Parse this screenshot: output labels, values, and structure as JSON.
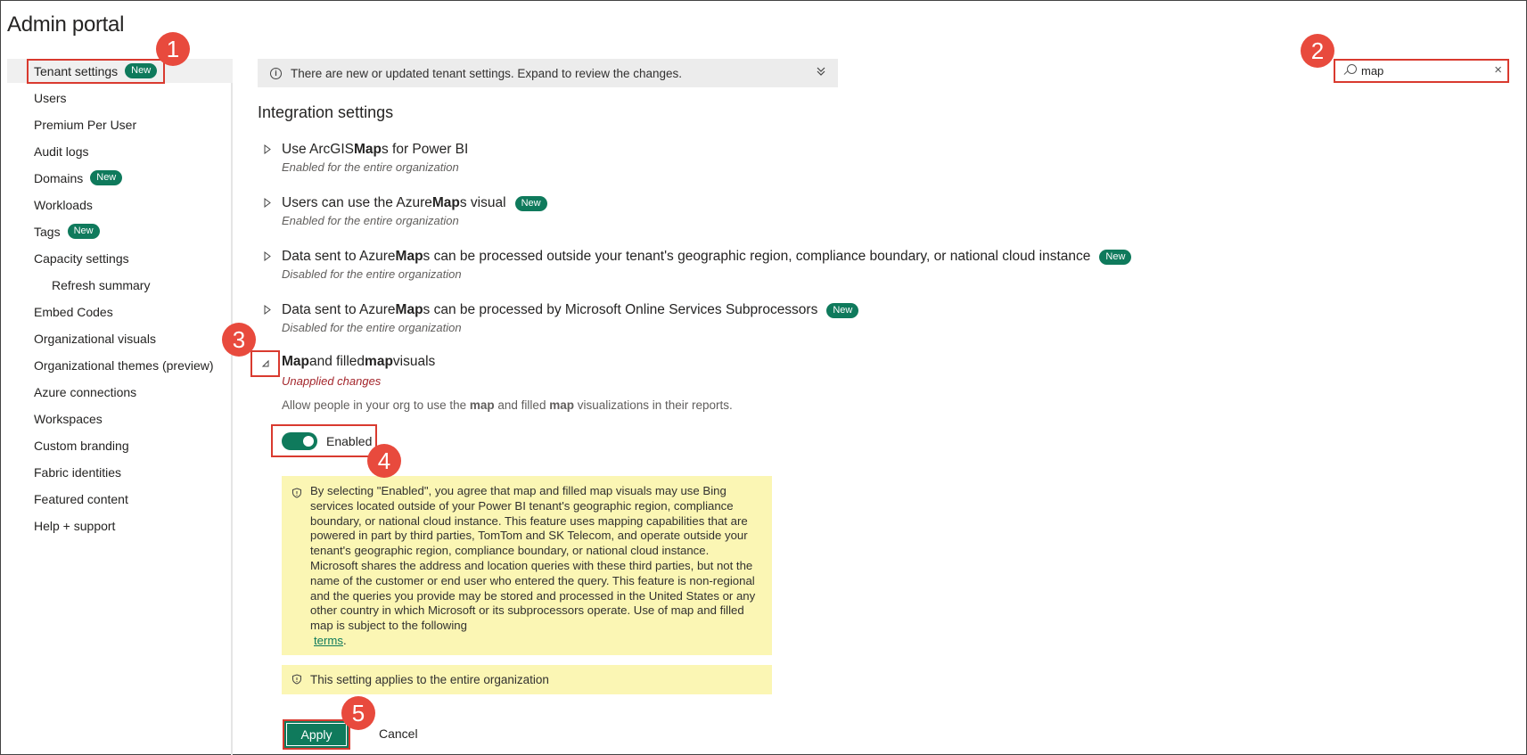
{
  "app": {
    "title": "Admin portal"
  },
  "sidebar": {
    "items": [
      {
        "label": "Tenant settings",
        "badge": "New",
        "active": true
      },
      {
        "label": "Users"
      },
      {
        "label": "Premium Per User"
      },
      {
        "label": "Audit logs"
      },
      {
        "label": "Domains",
        "badge": "New"
      },
      {
        "label": "Workloads"
      },
      {
        "label": "Tags",
        "badge": "New"
      },
      {
        "label": "Capacity settings"
      },
      {
        "label": "Refresh summary",
        "sub": true
      },
      {
        "label": "Embed Codes"
      },
      {
        "label": "Organizational visuals"
      },
      {
        "label": "Organizational themes (preview)"
      },
      {
        "label": "Azure connections"
      },
      {
        "label": "Workspaces"
      },
      {
        "label": "Custom branding"
      },
      {
        "label": "Fabric identities"
      },
      {
        "label": "Featured content"
      },
      {
        "label": "Help + support"
      }
    ]
  },
  "banner": {
    "text": "There are new or updated tenant settings. Expand to review the changes."
  },
  "search": {
    "value": "map",
    "placeholder": ""
  },
  "section": {
    "title": "Integration settings"
  },
  "settings": [
    {
      "title_pre": "Use ArcGIS ",
      "title_bold": "Map",
      "title_post": "s for Power BI",
      "status": "Enabled for the entire organization",
      "badge": ""
    },
    {
      "title_pre": "Users can use the Azure ",
      "title_bold": "Map",
      "title_post": "s visual",
      "status": "Enabled for the entire organization",
      "badge": "New"
    },
    {
      "title_pre": "Data sent to Azure ",
      "title_bold": "Map",
      "title_post": "s can be processed outside your tenant's geographic region, compliance boundary, or national cloud instance",
      "status": "Disabled for the entire organization",
      "badge": "New"
    },
    {
      "title_pre": "Data sent to Azure ",
      "title_bold": "Map",
      "title_post": "s can be processed by Microsoft Online Services Subprocessors",
      "status": "Disabled for the entire organization",
      "badge": "New"
    }
  ],
  "expanded": {
    "title_b1": "Map",
    "title_mid": " and filled ",
    "title_b2": "map",
    "title_post": " visuals",
    "unapplied": "Unapplied changes",
    "desc_pre": "Allow people in your org to use the ",
    "desc_b1": "map",
    "desc_mid": " and filled ",
    "desc_b2": "map",
    "desc_post": " visualizations in their reports.",
    "toggle_label": "Enabled",
    "toggle_on": true,
    "warning": "By selecting \"Enabled\", you agree that map and filled map visuals may use Bing services located outside of your Power BI tenant's geographic region, compliance boundary, or national cloud instance. This feature uses mapping capabilities that are powered in part by third parties, TomTom and SK Telecom, and operate outside your tenant's geographic region, compliance boundary, or national cloud instance. Microsoft shares the address and location queries with these third parties, but not the name of the customer or end user who entered the query. This feature is non-regional and the queries you provide may be stored and processed in the United States or any other country in which Microsoft or its subprocessors operate. Use of map and filled map is subject to the following",
    "warning_link": "terms",
    "warning_end": ".",
    "note": "This setting applies to the entire organization",
    "apply_label": "Apply",
    "cancel_label": "Cancel"
  },
  "callouts": [
    "1",
    "2",
    "3",
    "4",
    "5"
  ],
  "colors": {
    "accent": "#0f7a5c",
    "highlight": "#d93a2f",
    "callout": "#e84a3d",
    "warning_bg": "#fbf6b4",
    "unapplied": "#a4262c"
  },
  "icons": {
    "banner": "info-icon",
    "banner_toggle": "chevron-double-down-icon",
    "search": "search-icon",
    "clear": "close-icon",
    "caret": "caret-right-icon",
    "shield": "shield-icon"
  }
}
